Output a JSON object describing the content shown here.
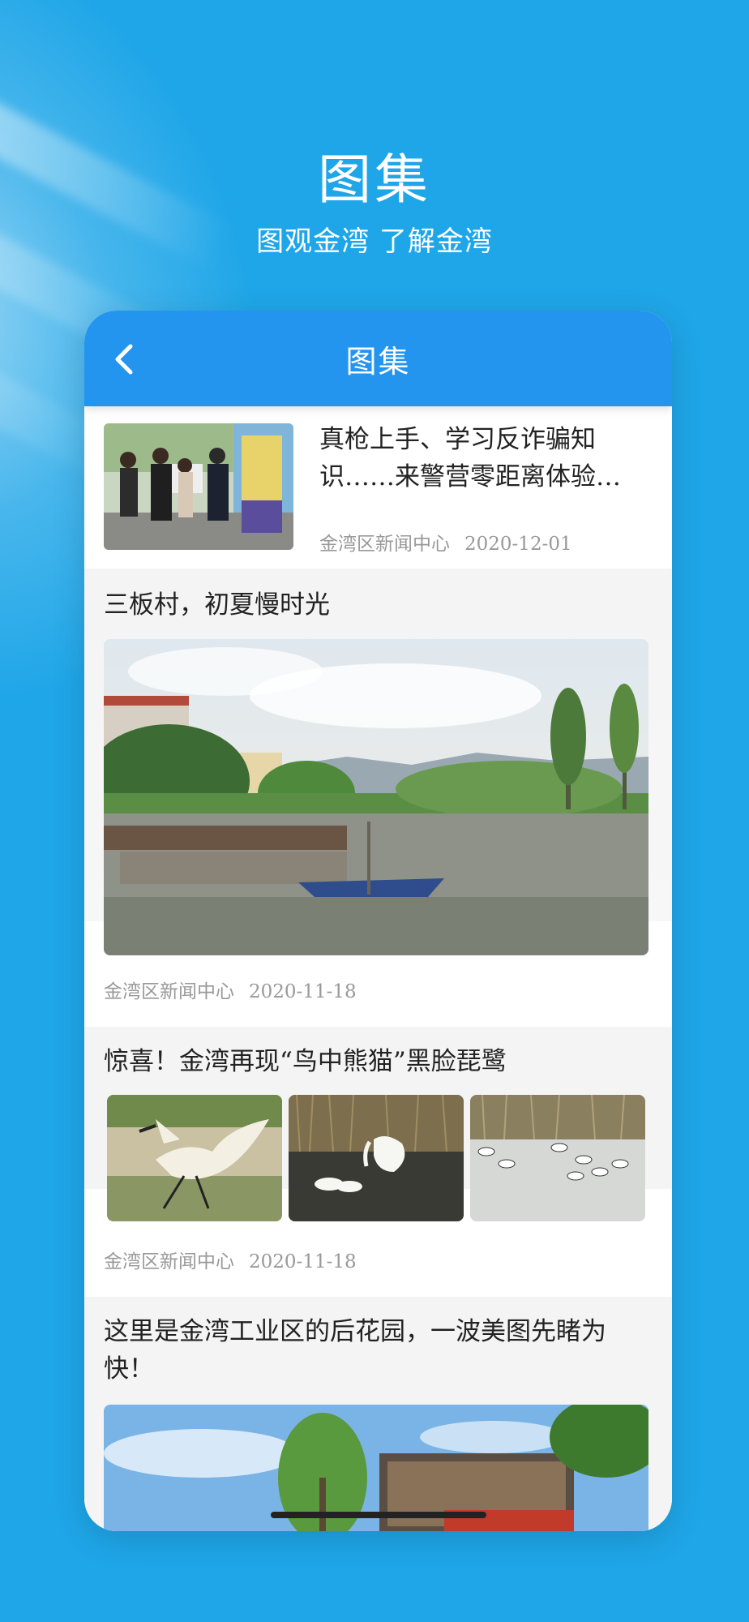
{
  "promo": {
    "title": "图集",
    "subtitle": "图观金湾 了解金湾"
  },
  "nav": {
    "title": "图集",
    "back_icon": "chevron-left-icon"
  },
  "articles": [
    {
      "title": "真枪上手、学习反诈骗知识……来警营零距离体验…",
      "source": "金湾区新闻中心",
      "date": "2020-12-01"
    },
    {
      "title": "三板村，初夏慢时光",
      "source": "金湾区新闻中心",
      "date": "2020-11-18"
    },
    {
      "title": "惊喜！金湾再现“鸟中熊猫”黑脸琵鹭",
      "source": "金湾区新闻中心",
      "date": "2020-11-18"
    },
    {
      "title": "这里是金湾工业区的后花园，一波美图先睹为快！"
    }
  ],
  "colors": {
    "background": "#1fa6e8",
    "nav": "#2495ef",
    "meta_text": "#999999"
  }
}
